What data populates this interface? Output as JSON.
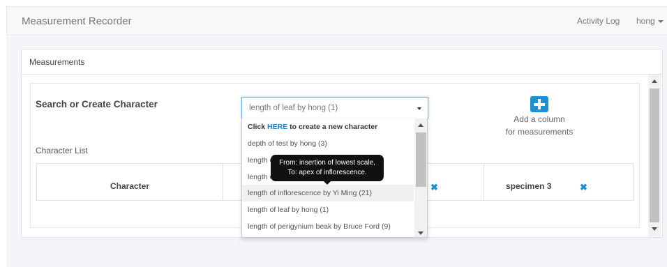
{
  "navbar": {
    "brand": "Measurement Recorder",
    "activity_log": "Activity Log",
    "user": "hong"
  },
  "panel": {
    "title": "Measurements"
  },
  "search": {
    "label": "Search or Create Character",
    "selected_value": "length of leaf by hong (1)"
  },
  "add_column": {
    "line1": "Add a column",
    "line2": "for measurements"
  },
  "character_list": {
    "label": "Character List",
    "header_character": "Character",
    "header_specimen": "specimen 3"
  },
  "dropdown": {
    "create_prefix": "Click ",
    "create_link": "HERE",
    "create_suffix": " to create a new character",
    "items": [
      "depth of test by hong (3)",
      "length o",
      "length o",
      "length of inflorescence by Yi Ming (21)",
      "length of leaf by hong (1)",
      "length of perigynium beak by Bruce Ford (9)"
    ]
  },
  "tooltip": {
    "line1": "From: insertion of lowest scale,",
    "line2": "To: apex of inflorescence."
  },
  "colors": {
    "accent": "#1e8fd6",
    "link": "#1e7fc8",
    "tooltip_bg": "#111111"
  }
}
